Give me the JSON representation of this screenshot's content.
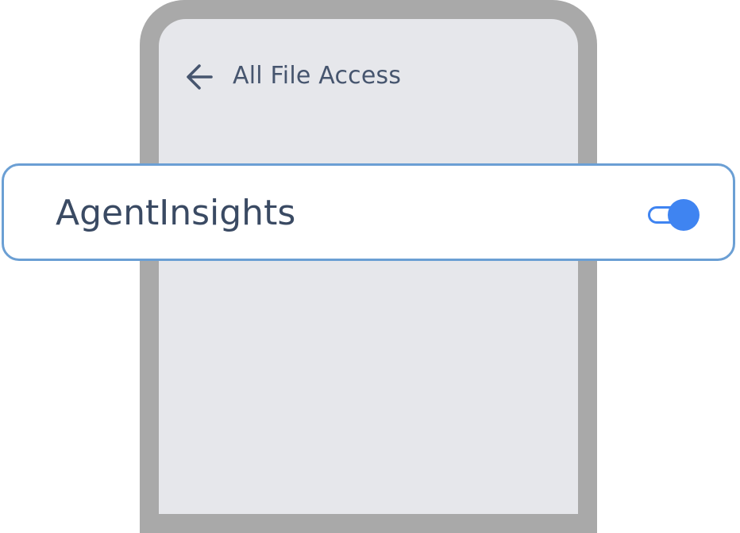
{
  "header": {
    "back_icon": "arrow-left-icon",
    "title": "All File Access"
  },
  "app_row": {
    "name": "AgentInsights",
    "toggle_state": "on",
    "accent_color": "#3f84f1"
  },
  "colors": {
    "frame": "#a9a9a9",
    "screen": "#e6e7eb",
    "row_border": "#6b9fd4",
    "text": "#46556e"
  }
}
